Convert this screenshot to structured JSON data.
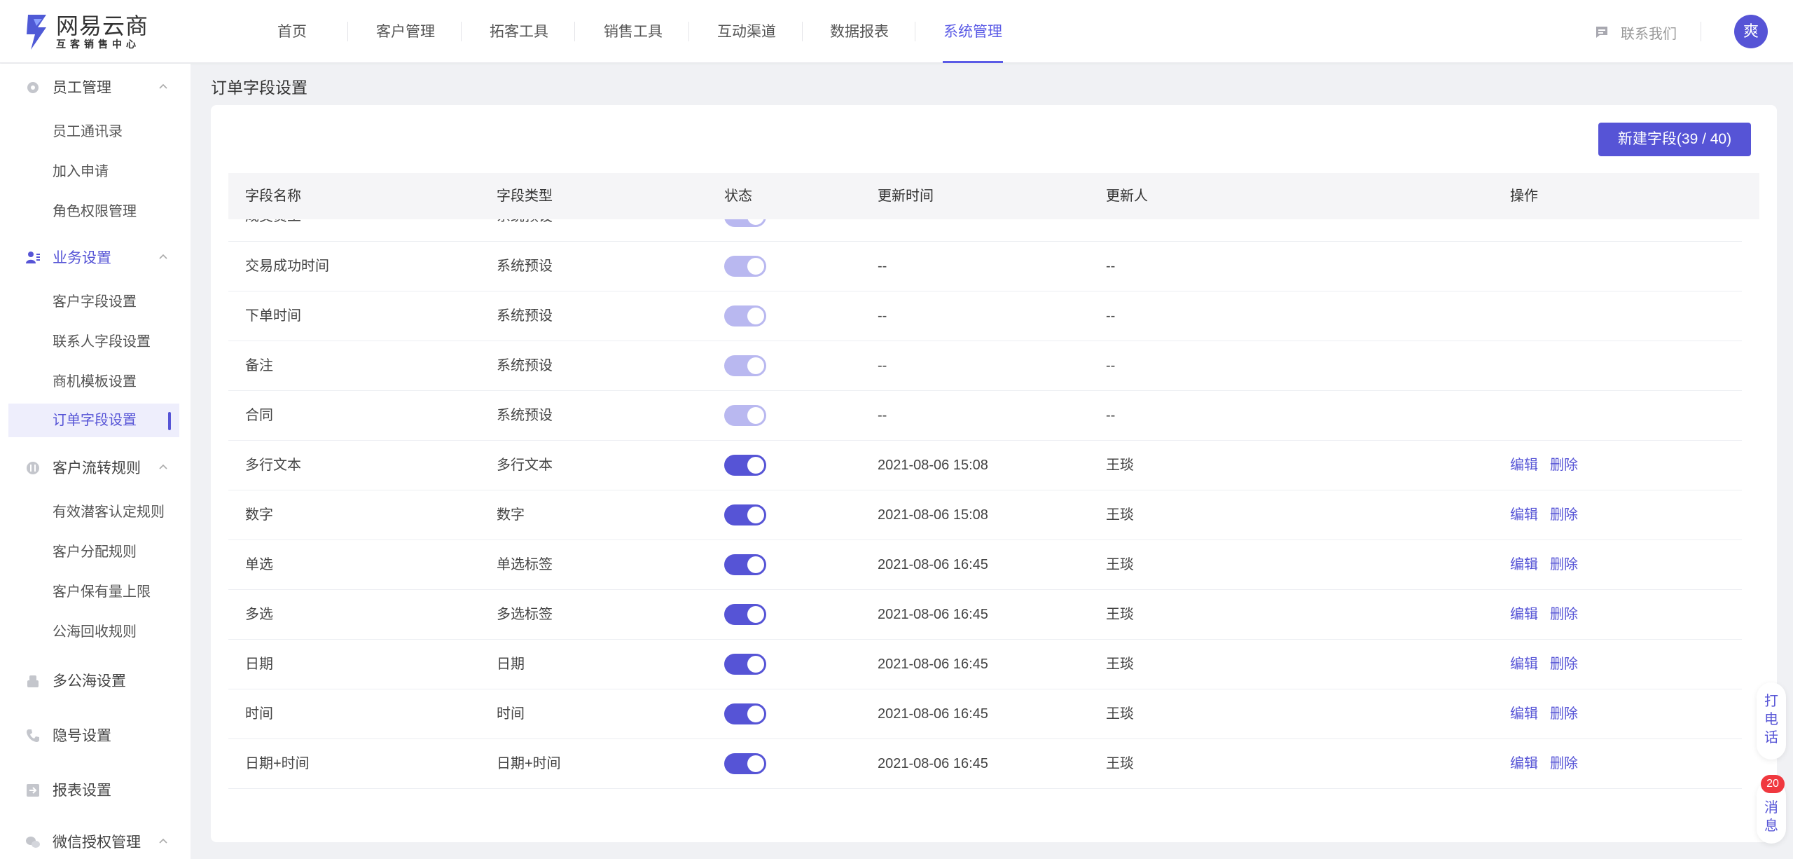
{
  "header": {
    "logo_title": "网易云商",
    "logo_subtitle": "互客销售中心",
    "nav": [
      "首页",
      "客户管理",
      "拓客工具",
      "销售工具",
      "互动渠道",
      "数据报表",
      "系统管理"
    ],
    "active_nav": "系统管理",
    "contact_label": "联系我们",
    "avatar_text": "爽"
  },
  "sidebar": {
    "groups": [
      {
        "label": "员工管理",
        "icon": "gear-icon",
        "items": [
          "员工通讯录",
          "加入申请",
          "角色权限管理"
        ]
      },
      {
        "label": "业务设置",
        "icon": "user-settings-icon",
        "items": [
          "客户字段设置",
          "联系人字段设置",
          "商机模板设置",
          "订单字段设置"
        ]
      },
      {
        "label": "客户流转规则",
        "icon": "flow-icon",
        "items": [
          "有效潜客认定规则",
          "客户分配规则",
          "客户保有量上限",
          "公海回收规则"
        ]
      },
      {
        "label": "多公海设置",
        "icon": "sea-icon",
        "items": []
      },
      {
        "label": "隐号设置",
        "icon": "phone-icon",
        "items": []
      },
      {
        "label": "报表设置",
        "icon": "report-icon",
        "items": []
      },
      {
        "label": "微信授权管理",
        "icon": "wechat-icon",
        "items": []
      }
    ],
    "active_group": "业务设置",
    "active_item": "订单字段设置"
  },
  "main": {
    "title": "订单字段设置",
    "new_button": "新建字段(39 / 40)",
    "columns": [
      "字段名称",
      "字段类型",
      "状态",
      "更新时间",
      "更新人",
      "操作"
    ],
    "rows": [
      {
        "name": "成交员工",
        "type": "系统预设",
        "enabled": true,
        "system": true,
        "time": "--",
        "updater": "--",
        "edit": "",
        "delete": ""
      },
      {
        "name": "交易成功时间",
        "type": "系统预设",
        "enabled": true,
        "system": true,
        "time": "--",
        "updater": "--",
        "edit": "",
        "delete": ""
      },
      {
        "name": "下单时间",
        "type": "系统预设",
        "enabled": true,
        "system": true,
        "time": "--",
        "updater": "--",
        "edit": "",
        "delete": ""
      },
      {
        "name": "备注",
        "type": "系统预设",
        "enabled": true,
        "system": true,
        "time": "--",
        "updater": "--",
        "edit": "",
        "delete": ""
      },
      {
        "name": "合同",
        "type": "系统预设",
        "enabled": true,
        "system": true,
        "time": "--",
        "updater": "--",
        "edit": "",
        "delete": ""
      },
      {
        "name": "多行文本",
        "type": "多行文本",
        "enabled": true,
        "system": false,
        "time": "2021-08-06 15:08",
        "updater": "王琰",
        "edit": "编辑",
        "delete": "删除"
      },
      {
        "name": "数字",
        "type": "数字",
        "enabled": true,
        "system": false,
        "time": "2021-08-06 15:08",
        "updater": "王琰",
        "edit": "编辑",
        "delete": "删除"
      },
      {
        "name": "单选",
        "type": "单选标签",
        "enabled": true,
        "system": false,
        "time": "2021-08-06 16:45",
        "updater": "王琰",
        "edit": "编辑",
        "delete": "删除"
      },
      {
        "name": "多选",
        "type": "多选标签",
        "enabled": true,
        "system": false,
        "time": "2021-08-06 16:45",
        "updater": "王琰",
        "edit": "编辑",
        "delete": "删除"
      },
      {
        "name": "日期",
        "type": "日期",
        "enabled": true,
        "system": false,
        "time": "2021-08-06 16:45",
        "updater": "王琰",
        "edit": "编辑",
        "delete": "删除"
      },
      {
        "name": "时间",
        "type": "时间",
        "enabled": true,
        "system": false,
        "time": "2021-08-06 16:45",
        "updater": "王琰",
        "edit": "编辑",
        "delete": "删除"
      },
      {
        "name": "日期+时间",
        "type": "日期+时间",
        "enabled": true,
        "system": false,
        "time": "2021-08-06 16:45",
        "updater": "王琰",
        "edit": "编辑",
        "delete": "删除"
      }
    ]
  },
  "floating": {
    "call_label": "打电话",
    "message_label": "消息",
    "message_count": "20"
  },
  "colors": {
    "accent": "#5654d6",
    "accent_light": "#b9b8f0",
    "badge": "#f0383f"
  }
}
